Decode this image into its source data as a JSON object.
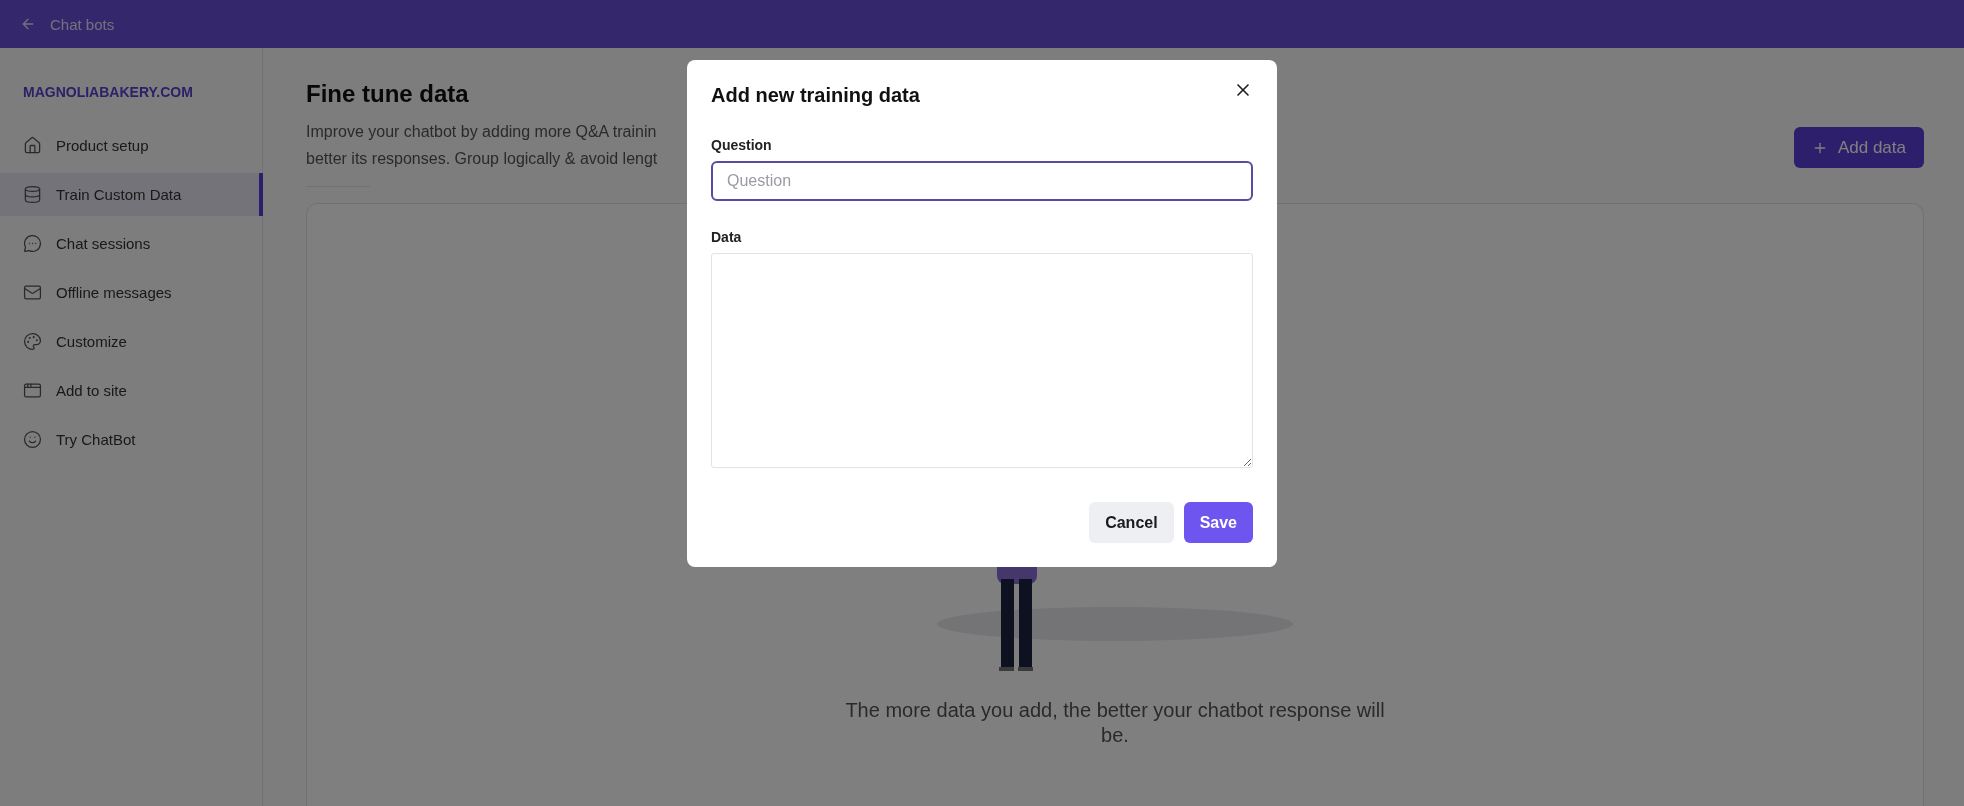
{
  "header": {
    "back_label": "Chat bots"
  },
  "sidebar": {
    "brand": "MAGNOLIABAKERY.COM",
    "items": [
      {
        "label": "Product setup",
        "selected": false
      },
      {
        "label": "Train Custom Data",
        "selected": true
      },
      {
        "label": "Chat sessions",
        "selected": false
      },
      {
        "label": "Offline messages",
        "selected": false
      },
      {
        "label": "Customize",
        "selected": false
      },
      {
        "label": "Add to site",
        "selected": false
      },
      {
        "label": "Try ChatBot",
        "selected": false
      }
    ]
  },
  "page": {
    "title": "Fine tune data",
    "description_lines": [
      "Improve your chatbot by adding more Q&A trainin",
      "better its responses. Group logically & avoid lengt"
    ],
    "add_button": "Add data"
  },
  "empty_state": {
    "message": "The more data you add, the better your chatbot response will be."
  },
  "modal": {
    "title": "Add new training data",
    "fields": [
      {
        "label": "Question",
        "kind": "input",
        "placeholder": "Question",
        "focused": true
      },
      {
        "label": "Data",
        "kind": "textarea",
        "focused": false
      }
    ],
    "buttons": [
      {
        "label": "Cancel",
        "kind": "secondary"
      },
      {
        "label": "Save",
        "kind": "primary"
      }
    ]
  }
}
